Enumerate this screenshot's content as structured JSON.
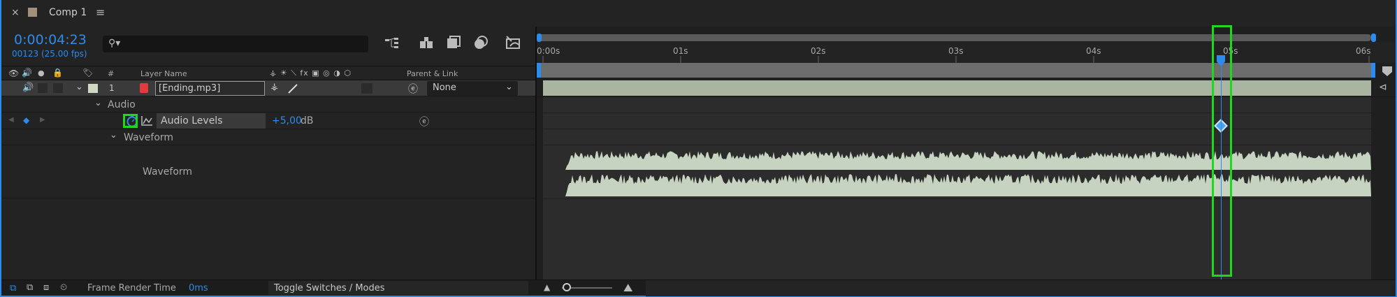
{
  "tab": {
    "close": "×",
    "title": "Comp 1",
    "menu": "≡"
  },
  "timecode": {
    "time": "0:00:04:23",
    "frames": "00123 (25.00 fps)"
  },
  "search": {
    "placeholder": ""
  },
  "columns": {
    "hash": "#",
    "layer_name": "Layer Name",
    "parent_link": "Parent & Link",
    "switch_icons": "⚶ ☀ ⟍ fx ▣ ◎ ◑ ⬡"
  },
  "layer": {
    "number": "1",
    "name": "[Ending.mp3]",
    "parent_value": "None",
    "color": "#cfd9c4"
  },
  "audio_group": {
    "label": "Audio"
  },
  "audio_levels": {
    "label": "Audio Levels",
    "value": "+5,00",
    "unit": "dB"
  },
  "waveform_group": {
    "label": "Waveform"
  },
  "waveform_label": "Waveform",
  "ruler": {
    "ticks": [
      "0:00s",
      "01s",
      "02s",
      "03s",
      "04s",
      "05s",
      "06s"
    ]
  },
  "footer": {
    "render_label": "Frame Render Time",
    "render_value": "0ms",
    "toggle": "Toggle Switches / Modes"
  },
  "colors": {
    "accent": "#2d8ceb",
    "highlight": "#1ed81e",
    "layer_bar": "#a9b5a0",
    "waveform": "#c7d3c1",
    "layer_label": "#cfd9c4"
  }
}
